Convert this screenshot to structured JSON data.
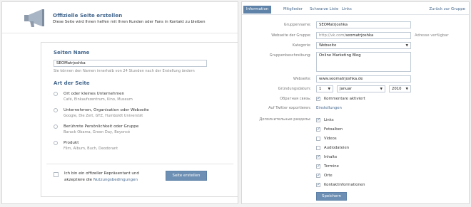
{
  "create": {
    "title": "Offizielle Seite erstellen",
    "subtitle": "Diese Seite wird Ihnen helfen mit Ihren Kunden oder Fans in Kontakt zu bleiben",
    "page_name_heading": "Seiten Name",
    "page_name_value": "SEOMatrjoshka",
    "page_name_hint": "Sie können den Namen innerhalb von 24 Stunden nach der Erstellung ändern",
    "type_heading": "Art der Seite",
    "types": [
      {
        "label": "Ort oder kleines Unternehmen",
        "sub": "Café, Einkaufszentrum, Kino, Museum"
      },
      {
        "label": "Unternehmen, Organisation oder Webseite",
        "sub": "Google, Die Zeit, GTZ, Humboldt Universtät"
      },
      {
        "label": "Berühmte Persönlichkeit oder Gruppe",
        "sub": "Barack Obama, Green Day, Beyoncé"
      },
      {
        "label": "Produkt",
        "sub": "Film, Album, Buch, Deodorant"
      }
    ],
    "confirm_line1": "Ich bin ein offizeller Repräsentant und",
    "confirm_line2": "akzeptiere die ",
    "confirm_link": "Nutzungsbedingungen",
    "create_button": "Seite erstellen"
  },
  "settings": {
    "tabs": [
      "Information",
      "Mitglieder",
      "Schwarze Liste",
      "Links"
    ],
    "back_link": "Zurück zur Gruppe",
    "group_name_label": "Gruppenname:",
    "group_name_value": "SEOMatrjoshka",
    "website_label": "Webseite der Gruppe:",
    "website_prefix": "http://vk.com/",
    "website_value": "seomatrjoshka",
    "website_status": "Adresse verfügbar",
    "category_label": "Kategorie:",
    "category_value": "Webseite",
    "description_label": "Gruppenbeschreibung:",
    "description_value": "Online Marketing Blog",
    "url_label": "Webseite:",
    "url_value": "www.seomatrjoshka.de",
    "founded_label": "Gründungsdatum:",
    "founded_day": "1",
    "founded_month": "Januar",
    "founded_year": "2010",
    "feedback_label": "Обратная связь:",
    "feedback_value": "Kommentare aktiviert",
    "twitter_label": "Auf Twitter exportieren:",
    "twitter_link": "Einstellungen",
    "sections_label": "Дополнительные разделы:",
    "sections": [
      {
        "label": "Links",
        "checked": true
      },
      {
        "label": "Fotoalben",
        "checked": true
      },
      {
        "label": "Videos",
        "checked": false
      },
      {
        "label": "Audiodateien",
        "checked": false
      },
      {
        "label": "Inhalte",
        "checked": true
      },
      {
        "label": "Termine",
        "checked": true
      },
      {
        "label": "Orte",
        "checked": true
      },
      {
        "label": "Kontaktinformationen",
        "checked": true
      }
    ],
    "save_button": "Speichern",
    "check_glyph": "✓",
    "arrow_glyph": "▼"
  },
  "colors": {
    "link": "#45688e",
    "button": "#6d8fb3",
    "active_tab": "#5e82a8"
  }
}
